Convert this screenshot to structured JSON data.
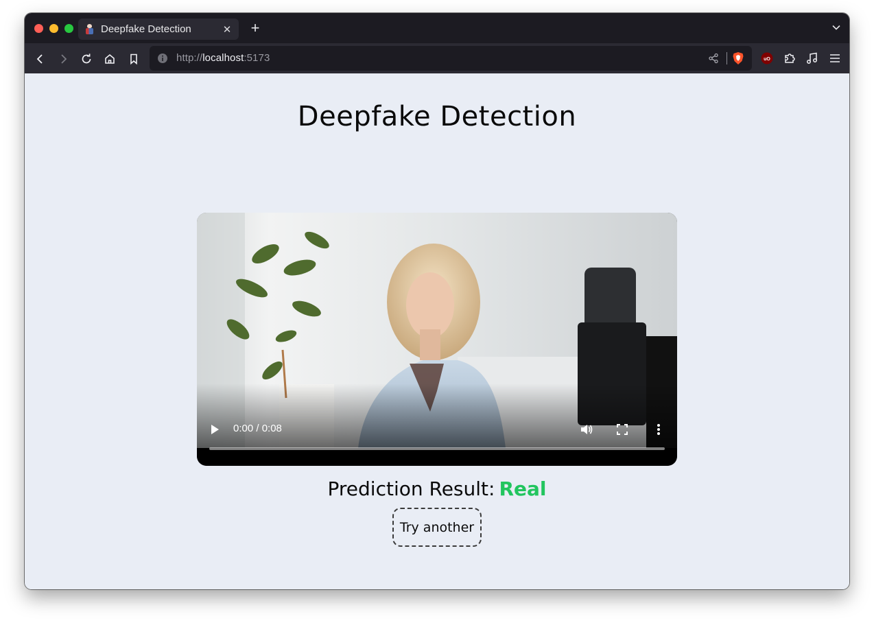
{
  "browser": {
    "tab_title": "Deepfake Detection",
    "url_scheme": "http://",
    "url_host": "localhost",
    "url_port": ":5173",
    "traffic_lights": {
      "close": "#ff5f57",
      "minimize": "#febc2e",
      "maximize": "#28c840"
    }
  },
  "page": {
    "title": "Deepfake Detection",
    "video": {
      "time_display": "0:00 / 0:08",
      "progress_fraction": 0.0
    },
    "result_label": "Prediction Result:",
    "result_value": "Real",
    "result_color": "#22c55e",
    "try_another_label": "Try another"
  },
  "icons": {
    "tab_bar": [
      "favicon-icon",
      "close-icon",
      "plus-icon",
      "chevron-down-icon"
    ],
    "nav_bar": [
      "back-icon",
      "forward-icon",
      "reload-icon",
      "home-icon",
      "bookmark-icon",
      "info-icon",
      "share-icon",
      "brave-shield-icon",
      "ublock-icon",
      "extensions-icon",
      "music-icon",
      "menu-icon"
    ],
    "video_controls": [
      "play-icon",
      "volume-icon",
      "fullscreen-icon",
      "more-options-icon"
    ]
  }
}
